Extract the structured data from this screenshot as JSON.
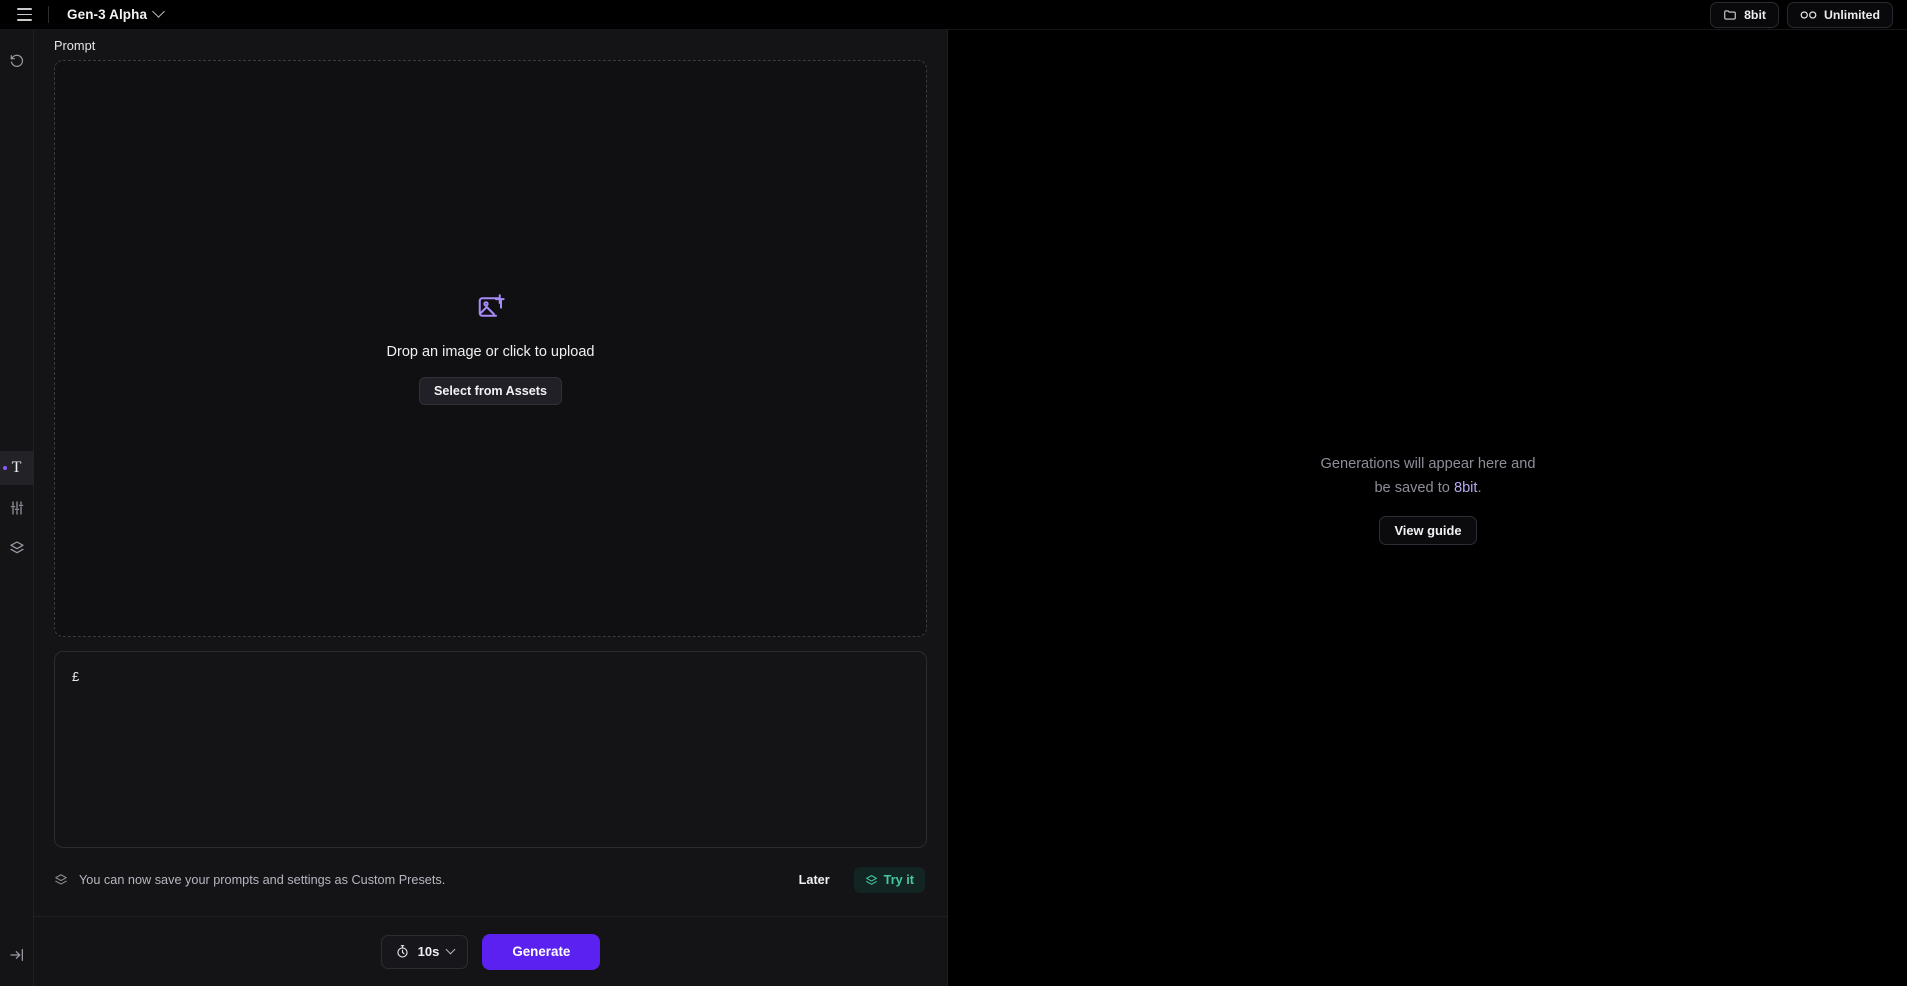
{
  "topbar": {
    "menu_icon": "hamburger-icon",
    "model_name": "Gen-3 Alpha",
    "model_chevron_icon": "chevron-down-icon",
    "folder_icon": "folder-icon",
    "folder_label": "8bit",
    "plan_icon": "infinity-icon",
    "plan_label": "Unlimited"
  },
  "rail": {
    "items": [
      {
        "name": "history-icon",
        "label": "History",
        "active": false
      },
      {
        "name": "text-tool-icon",
        "label": "T",
        "active": true
      },
      {
        "name": "sliders-icon",
        "label": "Settings",
        "active": false
      },
      {
        "name": "layers-icon",
        "label": "Layers",
        "active": false
      },
      {
        "name": "collapse-panel-icon",
        "label": "Collapse",
        "active": false
      }
    ]
  },
  "panel": {
    "title": "Prompt",
    "dropzone": {
      "icon": "image-plus-icon",
      "text": "Drop an image or click to upload",
      "button_label": "Select from Assets"
    },
    "prompt": {
      "value": "£",
      "placeholder": ""
    },
    "toast": {
      "icon": "layers-icon",
      "message": "You can now save your prompts and settings as Custom Presets.",
      "later_label": "Later",
      "try_icon": "layers-icon",
      "try_label": "Try it"
    },
    "footer": {
      "duration_icon": "stopwatch-icon",
      "duration_value": "10s",
      "duration_chevron_icon": "chevron-down-icon",
      "generate_label": "Generate"
    }
  },
  "canvas": {
    "empty_line1": "Generations will appear here and",
    "empty_line2_prefix": "be saved to ",
    "empty_link": "8bit",
    "empty_line2_suffix": ".",
    "guide_label": "View guide"
  },
  "colors": {
    "accent_purple": "#5b21f0",
    "link_purple": "#b9a8f2",
    "icon_purple": "#a78bfa",
    "try_green": "#46c9a0",
    "panel_bg": "#141417",
    "canvas_bg": "#000000"
  }
}
